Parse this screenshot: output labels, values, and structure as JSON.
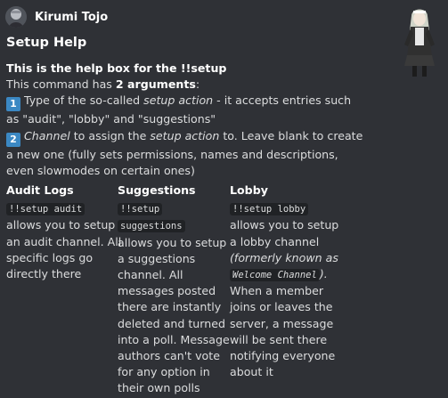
{
  "author": {
    "name": "Kirumi Tojo"
  },
  "title": "Setup Help",
  "description": {
    "heading": "This is the help box for the !!setup",
    "args_pre": "This command has ",
    "args_bold": "2 arguments",
    "args_post": ":",
    "arg1_num": "1",
    "arg1_pre": "Type of the so-called ",
    "arg1_italic": "setup action",
    "arg1_post": " - it accepts entries such",
    "arg1_line2": "as \"audit\", \"lobby\" and \"suggestions\"",
    "arg2_num": "2",
    "arg2_italic1": "Channel",
    "arg2_mid": " to assign the ",
    "arg2_italic2": "setup action",
    "arg2_post": " to. Leave blank to create",
    "arg2_line2": "a new one (fully sets permissions, names and descriptions,",
    "arg2_line3": "even slowmodes on certain ones)"
  },
  "fields": {
    "audit": {
      "name": "Audit Logs",
      "code": "!!setup audit",
      "lines": [
        "allows you to setup",
        "an audit channel. All",
        "specific logs go",
        "directly there"
      ]
    },
    "suggestions": {
      "name": "Suggestions",
      "code1": "!!setup",
      "code2": "suggestions",
      "lines": [
        "allows you to setup",
        "a suggestions",
        "channel. All",
        "messages posted",
        "there are instantly",
        "deleted and turned",
        "into a poll. Message",
        "authors can't vote",
        "for any option in",
        "their own polls"
      ]
    },
    "lobby": {
      "name": "Lobby",
      "code": "!!setup lobby",
      "line1": "allows you to setup",
      "line2": "a lobby channel",
      "italic1": "(formerly known as",
      "italic_code": "Welcome Channel",
      "italic_close": ").",
      "lines": [
        "When a member",
        "joins or leaves the",
        "server, a message",
        "will be sent there",
        "notifying everyone",
        "about it"
      ]
    }
  },
  "colors": {
    "background": "#2f3136",
    "text": "#dcddde",
    "heading": "#ffffff",
    "keycap": "#3b88c3"
  }
}
